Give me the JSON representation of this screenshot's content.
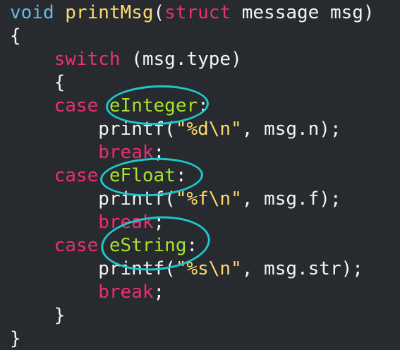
{
  "code": {
    "l1": {
      "kw": "void",
      "fn": "printMsg",
      "open": "(",
      "st": "struct",
      "rest": " message msg)"
    },
    "l2": {
      "text": "{"
    },
    "l3": {
      "kw": "switch",
      "rest": " (msg.type)"
    },
    "l4": {
      "text": "{"
    },
    "l5": {
      "kw": "case",
      "label": "eInteger",
      "colon": ":"
    },
    "l6": {
      "fn": "printf",
      "open": "(",
      "str": "\"%d\\n\"",
      "rest": ", msg.n);"
    },
    "l7": {
      "kw": "break",
      "semi": ";"
    },
    "l8": {
      "kw": "case",
      "label": "eFloat",
      "colon": ":"
    },
    "l9": {
      "fn": "printf",
      "open": "(",
      "str": "\"%f\\n\"",
      "rest": ", msg.f);"
    },
    "l10": {
      "kw": "break",
      "semi": ";"
    },
    "l11": {
      "kw": "case",
      "label": "eString",
      "colon": ":"
    },
    "l12": {
      "fn": "printf",
      "open": "(",
      "str": "\"%s\\n\"",
      "rest": ", msg.str);"
    },
    "l13": {
      "kw": "break",
      "semi": ";"
    },
    "l14": {
      "text": "}"
    },
    "l15": {
      "text": "}"
    }
  },
  "colors": {
    "background": "#272b2f",
    "type_keyword": "#64b8e6",
    "control_keyword": "#ee2d73",
    "function_name": "#ffd96a",
    "enum_label": "#a6e22e",
    "highlight_ellipse": "#1ec7c9"
  }
}
